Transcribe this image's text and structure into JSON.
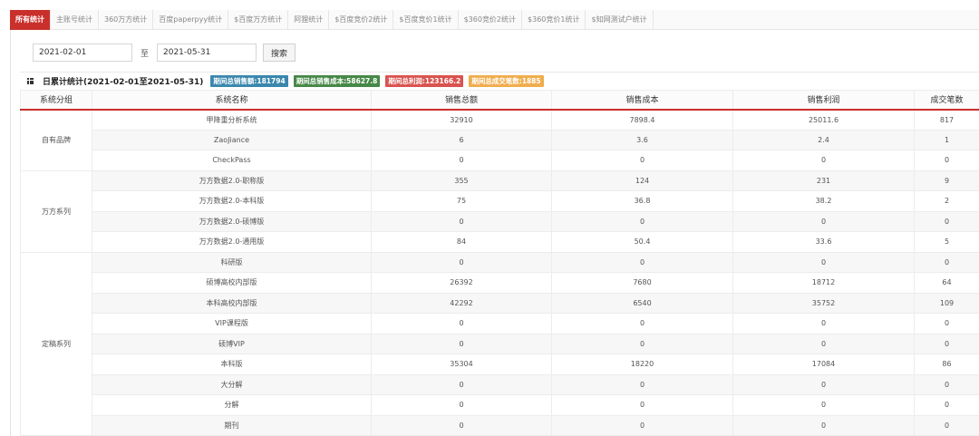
{
  "tabs": [
    {
      "label": "所有统计",
      "active": true
    },
    {
      "label": "主账号统计"
    },
    {
      "label": "360万方统计"
    },
    {
      "label": "百度paperpyy统计"
    },
    {
      "label": "$百度万方统计"
    },
    {
      "label": "阿狸统计"
    },
    {
      "label": "$百度竞价2统计"
    },
    {
      "label": "$百度竞价1统计"
    },
    {
      "label": "$360竞价2统计"
    },
    {
      "label": "$360竞价1统计"
    },
    {
      "label": "$知网测试户统计"
    }
  ],
  "filter": {
    "start_date": "2021-02-01",
    "to_label": "至",
    "end_date": "2021-05-31",
    "search_label": "搜索"
  },
  "panel": {
    "title": "日累计统计(2021-02-01至2021-05-31)",
    "badges": [
      {
        "text": "期间总销售额:181794",
        "color": "#3a87ad"
      },
      {
        "text": "期间总销售成本:58627.8",
        "color": "#468847"
      },
      {
        "text": "期间总利润:123166.2",
        "color": "#d9534f"
      },
      {
        "text": "期间总成交笔数:1885",
        "color": "#f0ad4e"
      }
    ]
  },
  "table": {
    "headers": [
      "系统分组",
      "系统名称",
      "销售总额",
      "销售成本",
      "销售利润",
      "成交笔数"
    ],
    "groups": [
      {
        "name": "自有品牌",
        "rows": [
          [
            "甲降重分析系统",
            "32910",
            "7898.4",
            "25011.6",
            "817"
          ],
          [
            "ZaoJiance",
            "6",
            "3.6",
            "2.4",
            "1"
          ],
          [
            "CheckPass",
            "0",
            "0",
            "0",
            "0"
          ]
        ]
      },
      {
        "name": "万方系列",
        "rows": [
          [
            "万方数据2.0-职称版",
            "355",
            "124",
            "231",
            "9"
          ],
          [
            "万方数据2.0-本科版",
            "75",
            "36.8",
            "38.2",
            "2"
          ],
          [
            "万方数据2.0-硕博版",
            "0",
            "0",
            "0",
            "0"
          ],
          [
            "万方数据2.0-通用版",
            "84",
            "50.4",
            "33.6",
            "5"
          ]
        ]
      },
      {
        "name": "定稿系列",
        "rows": [
          [
            "科研版",
            "0",
            "0",
            "0",
            "0"
          ],
          [
            "硕博高校内部版",
            "26392",
            "7680",
            "18712",
            "64"
          ],
          [
            "本科高校内部版",
            "42292",
            "6540",
            "35752",
            "109"
          ],
          [
            "VIP课程版",
            "0",
            "0",
            "0",
            "0"
          ],
          [
            "硕博VIP",
            "0",
            "0",
            "0",
            "0"
          ],
          [
            "本科版",
            "35304",
            "18220",
            "17084",
            "86"
          ],
          [
            "大分解",
            "0",
            "0",
            "0",
            "0"
          ],
          [
            "分解",
            "0",
            "0",
            "0",
            "0"
          ],
          [
            "期刊",
            "0",
            "0",
            "0",
            "0"
          ]
        ]
      }
    ]
  }
}
